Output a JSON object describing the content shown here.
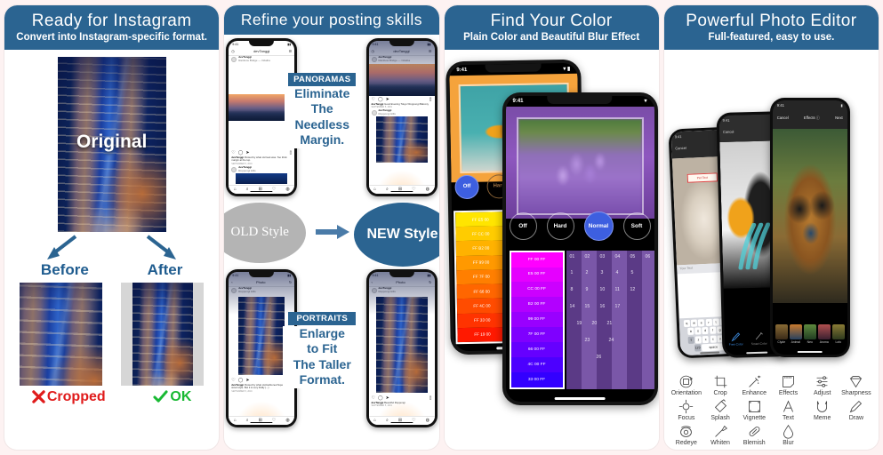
{
  "panels": [
    {
      "id": "ready-for-instagram",
      "title": "Ready for Instagram",
      "subtitle": "Convert into Instagram-specific format.",
      "original_label": "Original",
      "before_label": "Before",
      "after_label": "After",
      "before_verdict": "Cropped",
      "after_verdict": "OK",
      "before_icon": "cross-mark-icon",
      "after_icon": "check-mark-icon"
    },
    {
      "id": "refine-posting-skills",
      "title": "Refine your posting skills",
      "subtitle": "",
      "old_style_label": "OLD Style",
      "new_style_label": "NEW Style",
      "panorama_tag": "PANORAMAS",
      "panorama_text": "Eliminate\nThe\nNeedless\nMargin.",
      "panorama_lines": [
        "Eliminate",
        "The",
        "Needless",
        "Margin."
      ],
      "portrait_tag": "PORTRAITS",
      "portrait_lines": [
        "Enlarge",
        "to Fit",
        "The Taller",
        "Format."
      ],
      "feed": {
        "status_time": "9:41",
        "app_title": "devTanggi",
        "account": "devTanggi",
        "post1_location": "Rainbow Bridge — Odaiba",
        "post1_caption_user": "devTanggi",
        "post1_caption_old": "Posted by what old look was. Too thick margin at the top.",
        "post1_caption_new": "Good Evening Tokyo! Roppongi Balcony",
        "post1_date": "SEPTEMBER 5, 2019",
        "post2_location": "Roppongi Hills",
        "photo_title": "Photo",
        "photo_caption_old": "Posted by what old-fashioned Square-sized style. But it is very fiddly (...)",
        "photo_caption_new": "Beautiful Roppongi"
      }
    },
    {
      "id": "find-your-color",
      "title": "Find Your Color",
      "subtitle": "Plain Color and Beautiful Blur Effect",
      "status_time": "9:41",
      "blur_modes": [
        "Off",
        "Hard",
        "Normal",
        "Soft"
      ],
      "phone_back_selected_mode": "Off",
      "phone_front_selected_mode": "Normal",
      "swatches_orange": [
        "FF E5 00",
        "FF CC 00",
        "FF B2 00",
        "FF 99 00",
        "FF 7F 00",
        "FF 66 00",
        "FF 4C 00",
        "FF 33 00",
        "FF 19 00"
      ],
      "swatches_magenta": [
        "FF 00 FF",
        "E5 00 FF",
        "CC 00 FF",
        "B2 00 FF",
        "99 00 FF",
        "7F 00 FF",
        "66 00 FF",
        "4C 00 FF",
        "33 00 FF"
      ],
      "grid_col_headers": [
        "01",
        "02",
        "03",
        "04",
        "05",
        "06"
      ],
      "grid_numbers": [
        "1",
        "2",
        "3",
        "4",
        "5",
        "8",
        "9",
        "10",
        "11",
        "12",
        "14",
        "15",
        "16",
        "17",
        "19",
        "20",
        "21",
        "23",
        "24",
        "26"
      ]
    },
    {
      "id": "powerful-photo-editor",
      "title": "Powerful Photo Editor",
      "subtitle": "Full-featured, easy to use.",
      "status_time": "9:41",
      "nav_cancel": "Cancel",
      "nav_next": "Next",
      "nav_effects": "Effects",
      "text_placeholder": "Your Text",
      "sample_text": "Pet Text",
      "splash_tabs": [
        "Free Color",
        "Smart Color",
        "Size"
      ],
      "effect_thumbs": [
        "Clyde",
        "Animal",
        "Neo",
        "Aroma",
        "Lofo"
      ],
      "keyboard_rows": [
        [
          "q",
          "w",
          "e",
          "r",
          "t",
          "y",
          "u",
          "i",
          "o",
          "p"
        ],
        [
          "a",
          "s",
          "d",
          "f",
          "g",
          "h",
          "j",
          "k",
          "l"
        ],
        [
          "z",
          "x",
          "c",
          "v",
          "b",
          "n",
          "m"
        ]
      ],
      "keyboard_bottom": [
        "123",
        "space",
        "return"
      ],
      "tools": [
        {
          "label": "Orientation",
          "icon": "orientation-icon"
        },
        {
          "label": "Crop",
          "icon": "crop-icon"
        },
        {
          "label": "Enhance",
          "icon": "enhance-icon"
        },
        {
          "label": "Effects",
          "icon": "effects-icon"
        },
        {
          "label": "Adjust",
          "icon": "adjust-icon"
        },
        {
          "label": "Sharpness",
          "icon": "sharpness-icon"
        },
        {
          "label": "Focus",
          "icon": "focus-icon"
        },
        {
          "label": "Splash",
          "icon": "splash-icon"
        },
        {
          "label": "Vignette",
          "icon": "vignette-icon"
        },
        {
          "label": "Text",
          "icon": "text-icon"
        },
        {
          "label": "Meme",
          "icon": "meme-icon"
        },
        {
          "label": "Draw",
          "icon": "draw-icon"
        },
        {
          "label": "Redeye",
          "icon": "redeye-icon"
        },
        {
          "label": "Whiten",
          "icon": "whiten-icon"
        },
        {
          "label": "Blemish",
          "icon": "blemish-icon"
        },
        {
          "label": "Blur",
          "icon": "blur-icon"
        }
      ]
    }
  ],
  "colors": {
    "header_blue": "#2b6491",
    "accent_blue": "#1f5c8f",
    "bad_red": "#e01b1b",
    "good_green": "#19b933",
    "old_gray": "#b4b4b4",
    "page_background": "#fdf2f2",
    "selected_button_blue": "#3d5fe0"
  }
}
